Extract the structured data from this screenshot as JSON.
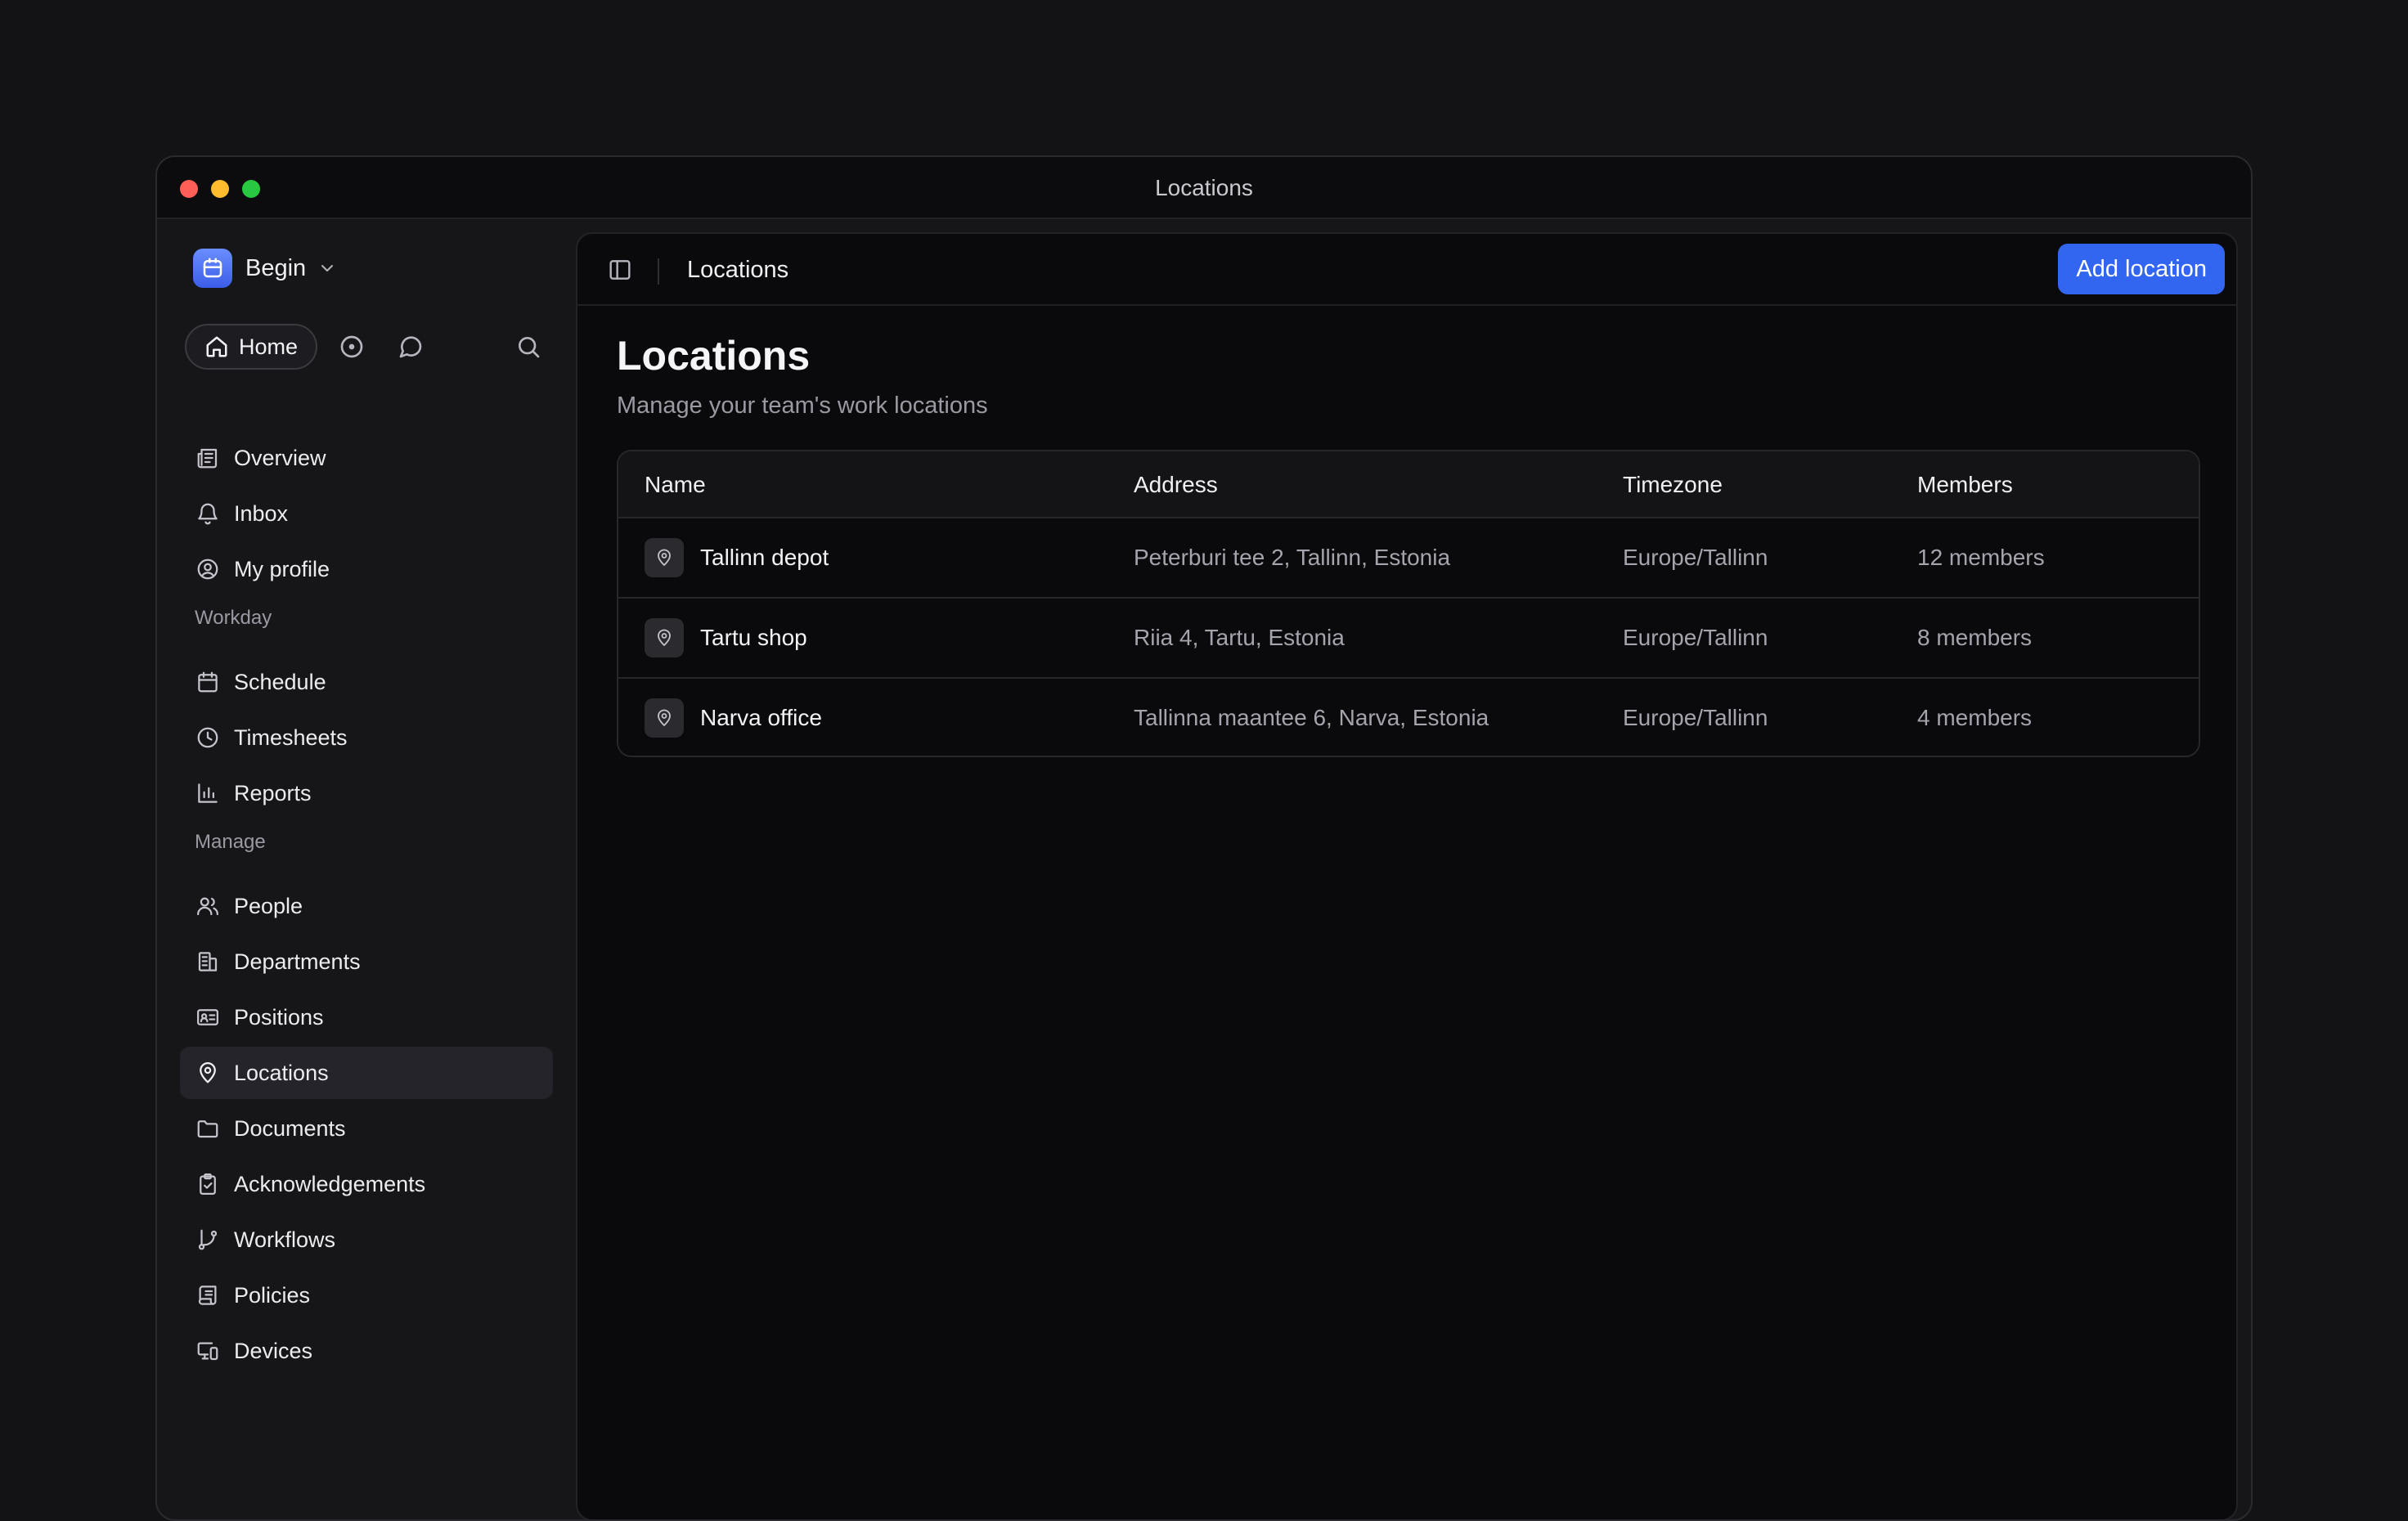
{
  "window": {
    "title": "Locations"
  },
  "workspace": {
    "name": "Begin"
  },
  "quick_nav": {
    "home_label": "Home"
  },
  "sidebar": {
    "top_items": [
      {
        "label": "Overview",
        "icon": "newspaper-icon"
      },
      {
        "label": "Inbox",
        "icon": "bell-icon"
      },
      {
        "label": "My profile",
        "icon": "user-circle-icon"
      }
    ],
    "sections": [
      {
        "label": "Workday",
        "items": [
          {
            "label": "Schedule",
            "icon": "calendar-icon"
          },
          {
            "label": "Timesheets",
            "icon": "clock-icon"
          },
          {
            "label": "Reports",
            "icon": "bar-chart-icon"
          }
        ]
      },
      {
        "label": "Manage",
        "items": [
          {
            "label": "People",
            "icon": "users-icon"
          },
          {
            "label": "Departments",
            "icon": "building-icon"
          },
          {
            "label": "Positions",
            "icon": "id-card-icon"
          },
          {
            "label": "Locations",
            "icon": "map-pin-icon",
            "active": true
          },
          {
            "label": "Documents",
            "icon": "folder-icon"
          },
          {
            "label": "Acknowledgements",
            "icon": "clipboard-check-icon"
          },
          {
            "label": "Workflows",
            "icon": "git-branch-icon"
          },
          {
            "label": "Policies",
            "icon": "scroll-icon"
          },
          {
            "label": "Devices",
            "icon": "devices-icon"
          }
        ]
      }
    ]
  },
  "header": {
    "title": "Locations",
    "add_button": "Add location"
  },
  "page": {
    "title": "Locations",
    "subtitle": "Manage your team's work locations"
  },
  "table": {
    "columns": [
      "Name",
      "Address",
      "Timezone",
      "Members"
    ],
    "rows": [
      {
        "name": "Tallinn depot",
        "address": "Peterburi tee 2, Tallinn, Estonia",
        "timezone": "Europe/Tallinn",
        "members": "12 members"
      },
      {
        "name": "Tartu shop",
        "address": "Riia 4, Tartu, Estonia",
        "timezone": "Europe/Tallinn",
        "members": "8 members"
      },
      {
        "name": "Narva office",
        "address": "Tallinna maantee 6, Narva, Estonia",
        "timezone": "Europe/Tallinn",
        "members": "4 members"
      }
    ]
  },
  "colors": {
    "accent": "#3366f0",
    "background": "#131316",
    "panel": "#0a0a0c"
  }
}
